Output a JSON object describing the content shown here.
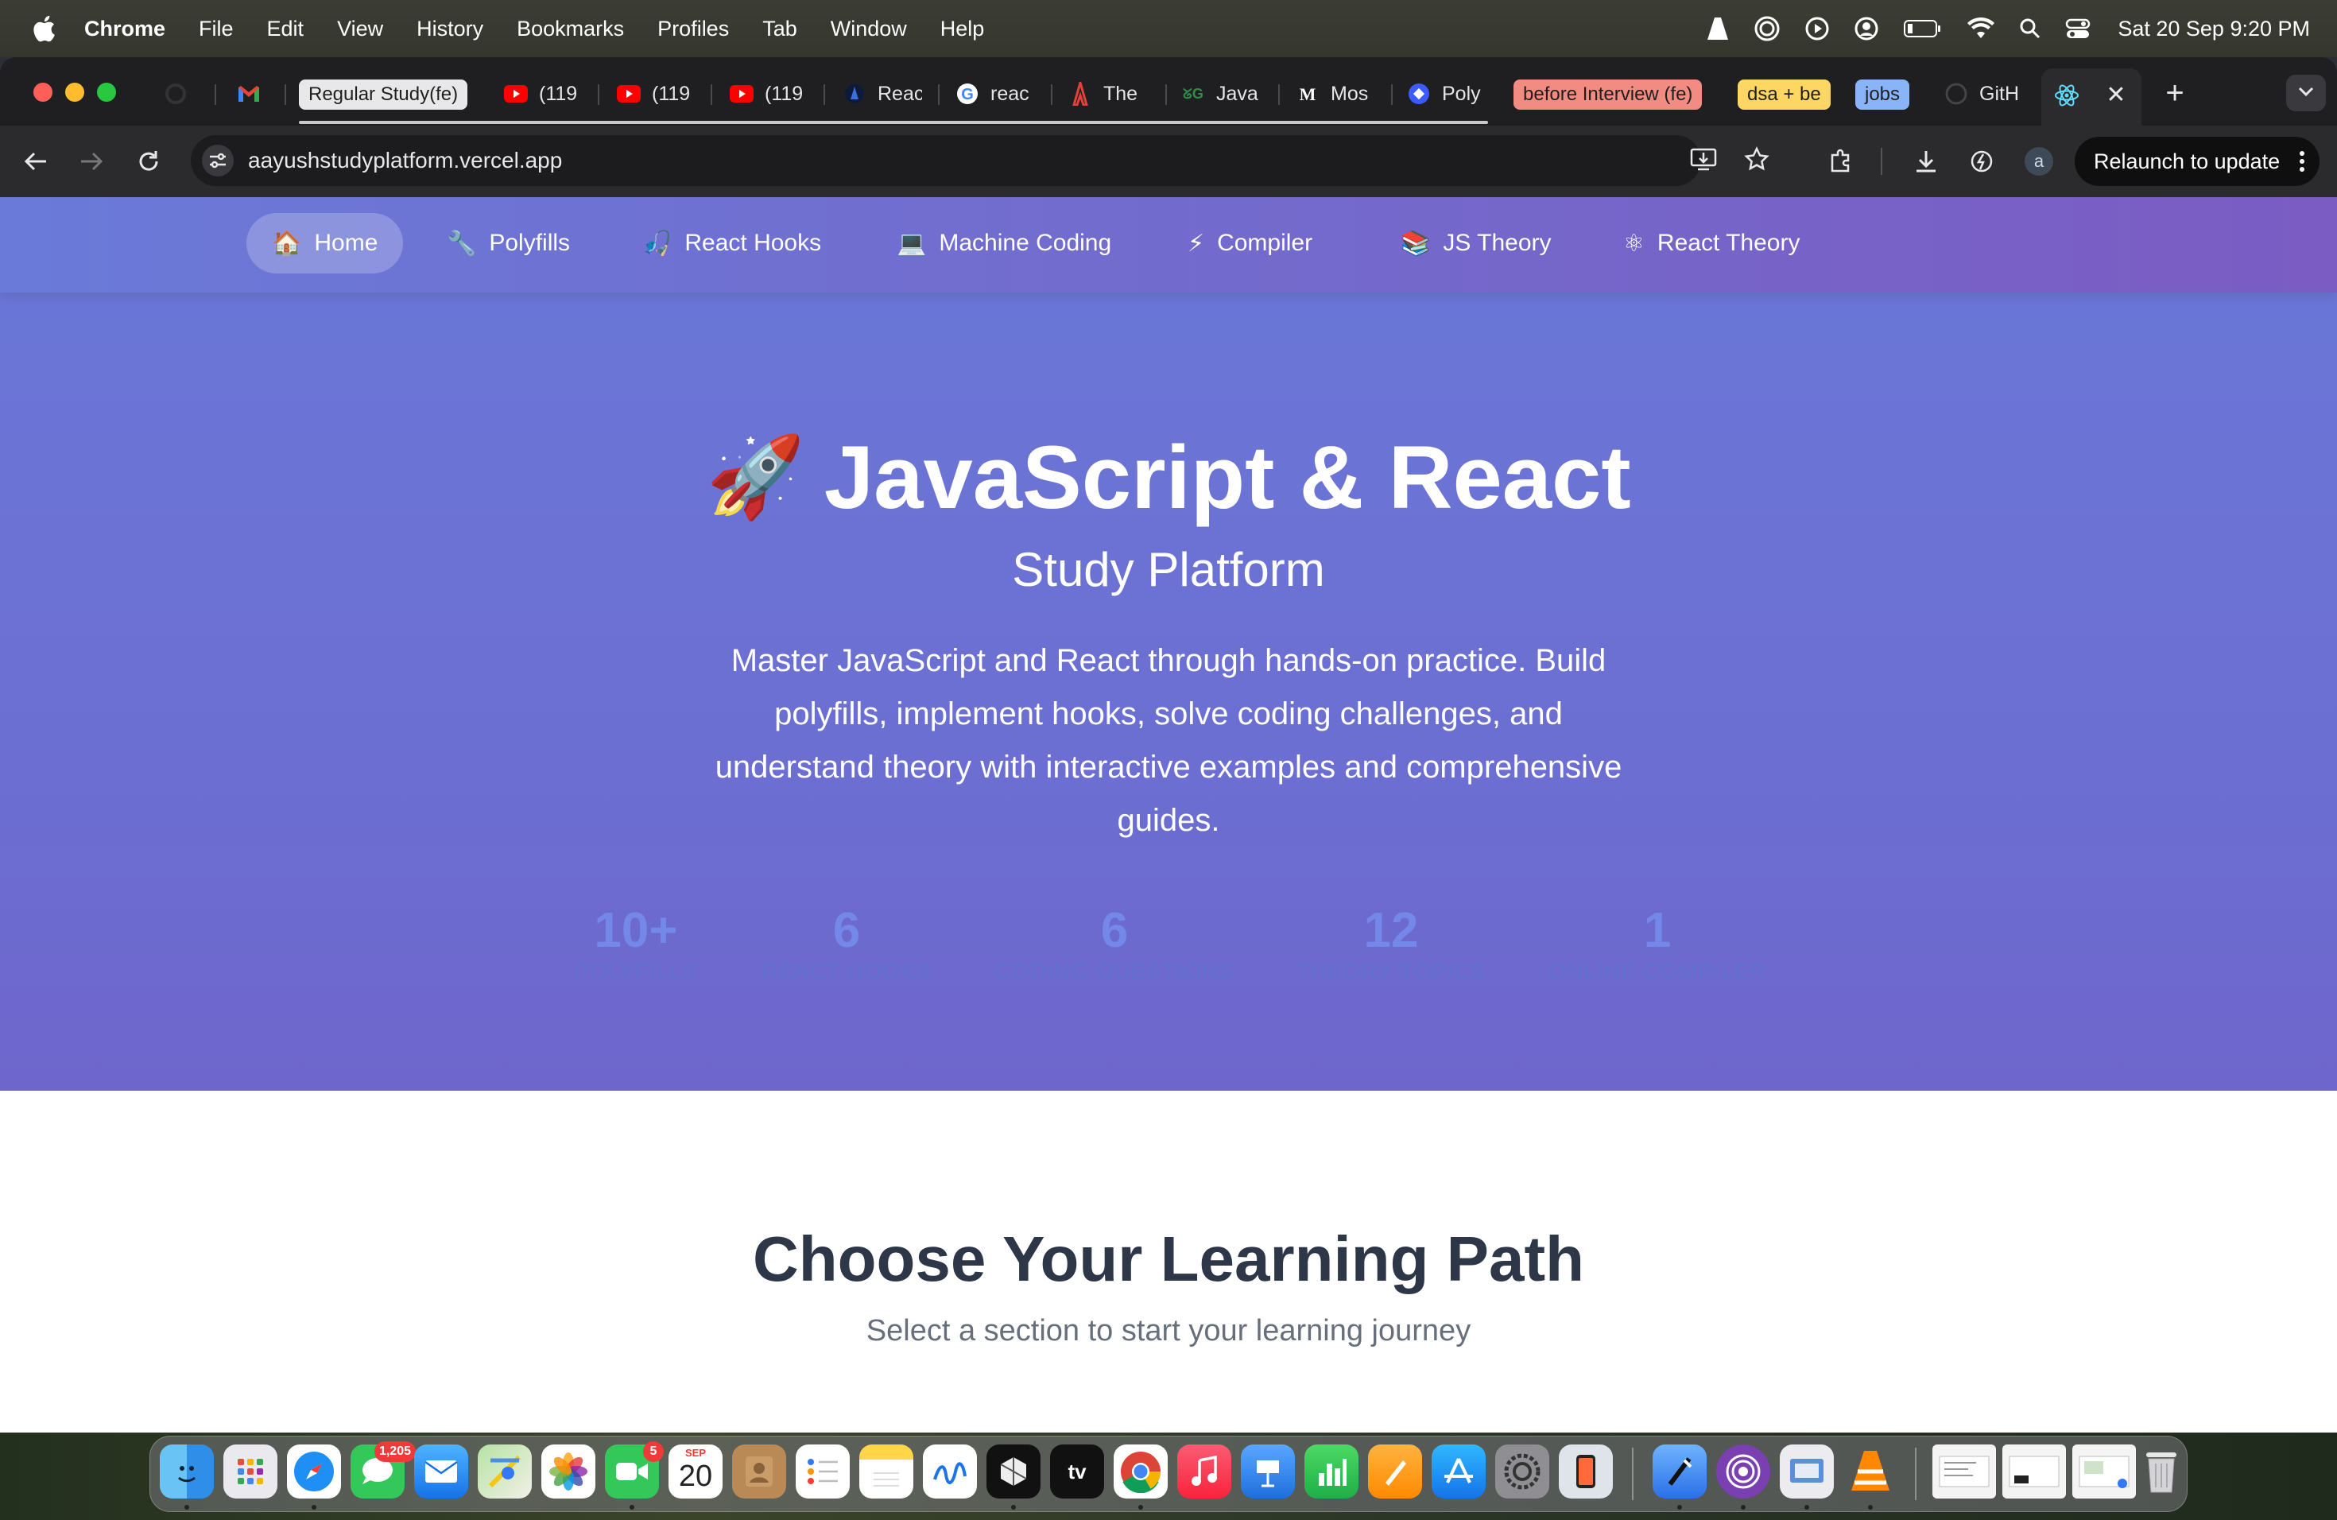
{
  "menubar": {
    "app": "Chrome",
    "items": [
      "File",
      "Edit",
      "View",
      "History",
      "Bookmarks",
      "Profiles",
      "Tab",
      "Window",
      "Help"
    ],
    "datetime": "Sat 20 Sep  9:20 PM"
  },
  "tabs": {
    "items": [
      {
        "label": "",
        "icon": "openai-icon"
      },
      {
        "label": "",
        "icon": "gmail-icon"
      },
      {
        "label": "Regular Study(fe)",
        "icon": "group-pill",
        "color": "#e8e8e8"
      },
      {
        "label": "(119",
        "icon": "youtube-icon"
      },
      {
        "label": "(119",
        "icon": "youtube-icon"
      },
      {
        "label": "(119",
        "icon": "youtube-icon"
      },
      {
        "label": "Reac",
        "icon": "site-icon"
      },
      {
        "label": "reac",
        "icon": "google-icon"
      },
      {
        "label": "The",
        "icon": "tower-icon"
      },
      {
        "label": "Java",
        "icon": "gfg-icon"
      },
      {
        "label": "Mos",
        "icon": "medium-icon"
      },
      {
        "label": "Poly",
        "icon": "diamond-icon"
      },
      {
        "label": "before Interview (fe)",
        "icon": "group-pill",
        "color": "#f28b82"
      },
      {
        "label": "dsa + be",
        "icon": "group-pill",
        "color": "#fdd663"
      },
      {
        "label": "jobs",
        "icon": "group-pill",
        "color": "#8ab4f8"
      },
      {
        "label": "GitH",
        "icon": "github-icon"
      }
    ],
    "active_icon": "react-icon"
  },
  "toolbar": {
    "url": "aayushstudyplatform.vercel.app",
    "relaunch_label": "Relaunch to update",
    "profile_initial": "a"
  },
  "nav": {
    "items": [
      {
        "label": "Home",
        "icon": "🏠"
      },
      {
        "label": "Polyfills",
        "icon": "🔧"
      },
      {
        "label": "React Hooks",
        "icon": "🎣"
      },
      {
        "label": "Machine Coding",
        "icon": "💻"
      },
      {
        "label": "Compiler",
        "icon": "⚡"
      },
      {
        "label": "JS Theory",
        "icon": "📚"
      },
      {
        "label": "React Theory",
        "icon": "⚛"
      }
    ]
  },
  "hero": {
    "rocket": "🚀",
    "title": "JavaScript & React",
    "subtitle": "Study Platform",
    "description": "Master JavaScript and React through hands-on practice. Build polyfills, implement hooks, solve coding challenges, and understand theory with interactive examples and comprehensive guides."
  },
  "stats": [
    {
      "value": "10+",
      "label": "POLYFILLS"
    },
    {
      "value": "6",
      "label": "REACT HOOKS"
    },
    {
      "value": "6",
      "label": "CODING QUESTIONS"
    },
    {
      "value": "12",
      "label": "THEORY TOPICS"
    },
    {
      "value": "1",
      "label": "ONLINE COMPILER"
    }
  ],
  "learning": {
    "title": "Choose Your Learning Path",
    "subtitle": "Select a section to start your learning journey"
  },
  "dock": {
    "messages_badge": "1,205",
    "facetime_badge": "5",
    "calendar_month": "SEP",
    "calendar_day": "20",
    "tv_label": "tv"
  }
}
